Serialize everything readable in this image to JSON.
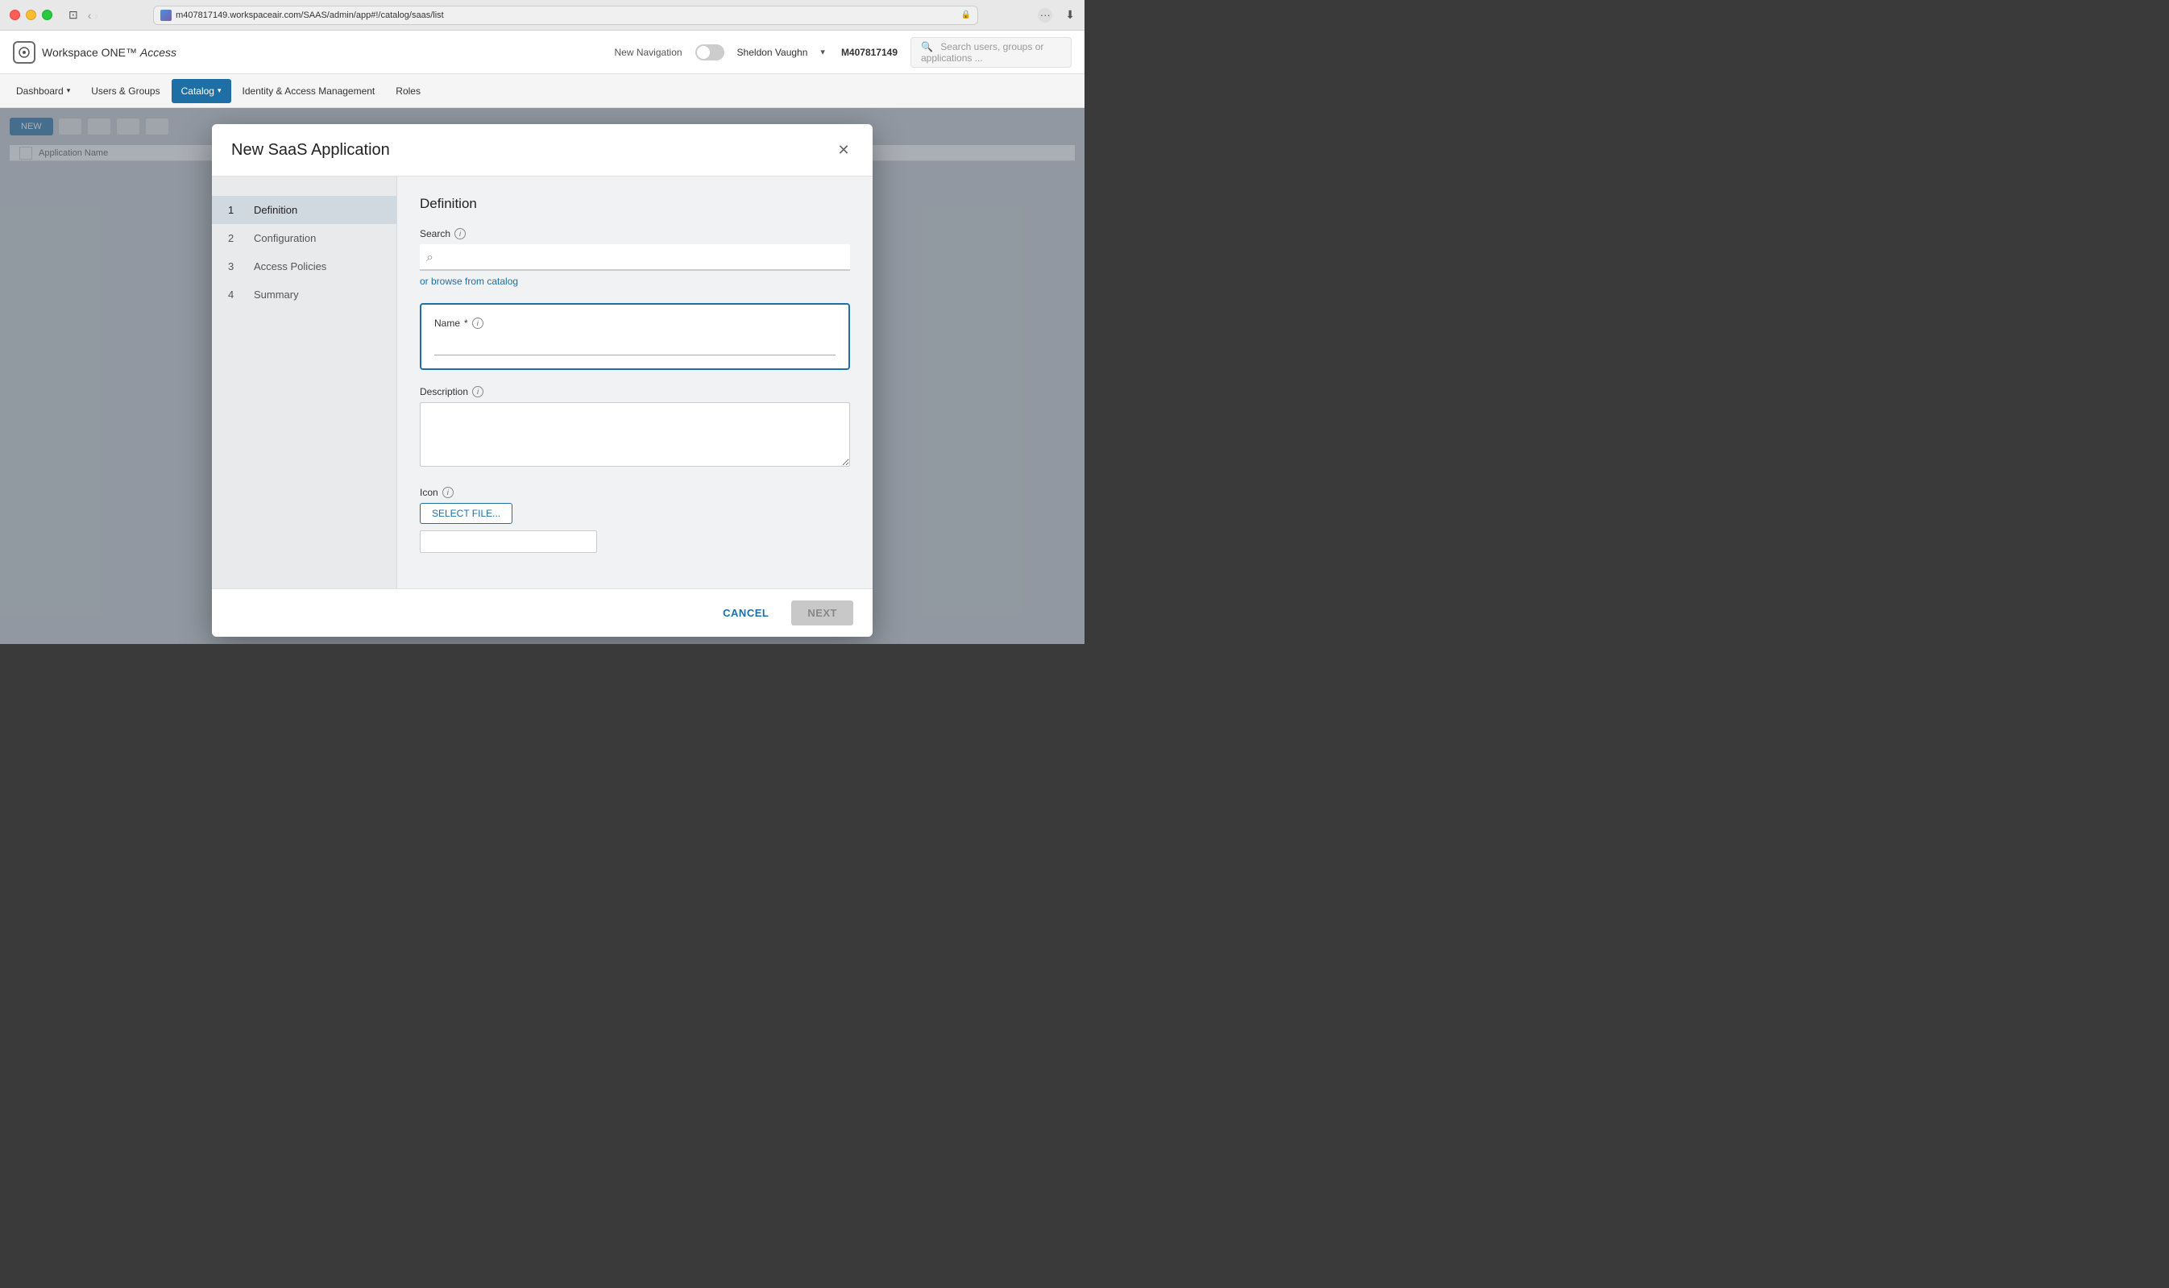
{
  "window": {
    "url": "m407817149.workspaceair.com/SAAS/admin/app#!/catalog/saas/list",
    "favicon_color": "#4a90e2"
  },
  "app": {
    "logo_text": "Workspace ONE",
    "logo_suffix": "Access",
    "new_nav_label": "New Navigation",
    "user_name": "Sheldon Vaughn",
    "user_org": "M407817149",
    "search_placeholder": "Search users, groups or applications ..."
  },
  "nav": {
    "items": [
      {
        "label": "Dashboard",
        "active": false,
        "has_caret": true
      },
      {
        "label": "Users & Groups",
        "active": false,
        "has_caret": false
      },
      {
        "label": "Catalog",
        "active": true,
        "has_caret": true
      },
      {
        "label": "Identity & Access Management",
        "active": false,
        "has_caret": false
      },
      {
        "label": "Roles",
        "active": false,
        "has_caret": false
      }
    ]
  },
  "background": {
    "new_button": "NEW"
  },
  "modal": {
    "title": "New SaaS Application",
    "wizard_steps": [
      {
        "num": "1",
        "label": "Definition",
        "active": true
      },
      {
        "num": "2",
        "label": "Configuration",
        "active": false
      },
      {
        "num": "3",
        "label": "Access Policies",
        "active": false
      },
      {
        "num": "4",
        "label": "Summary",
        "active": false
      }
    ],
    "section_title": "Definition",
    "search_label": "Search",
    "browse_link": "or browse from catalog",
    "name_label": "Name",
    "name_required": "*",
    "description_label": "Description",
    "icon_label": "Icon",
    "select_file_button": "SELECT FILE...",
    "cancel_button": "CANCEL",
    "next_button": "NEXT"
  }
}
